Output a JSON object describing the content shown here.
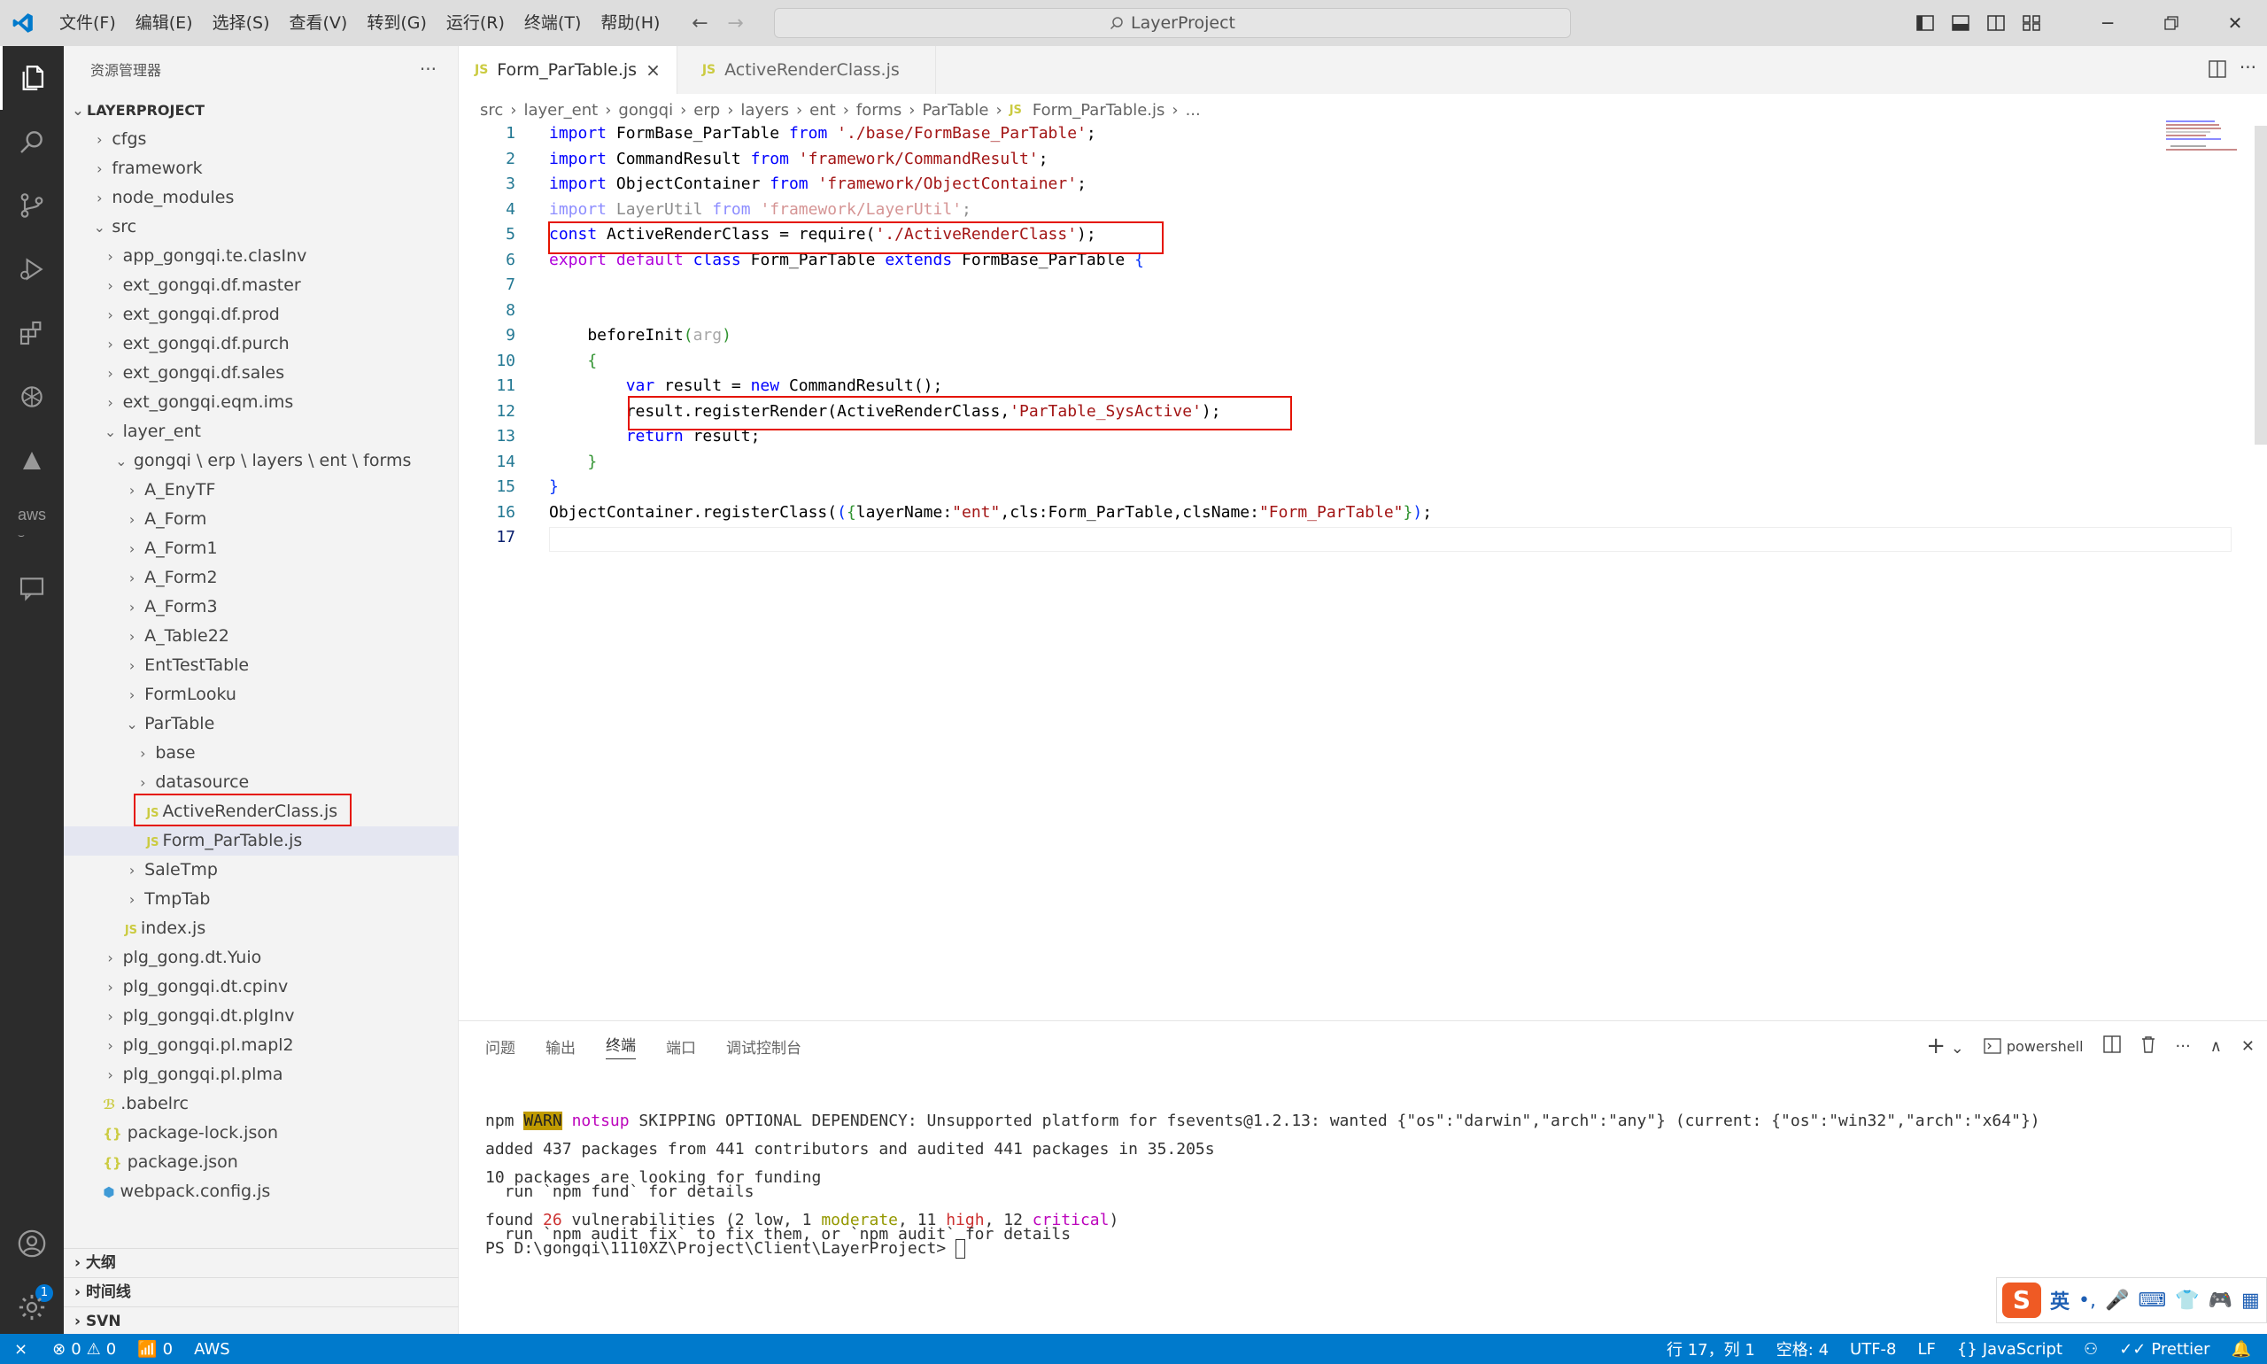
{
  "title_bar": {
    "menu": [
      "文件(F)",
      "编辑(E)",
      "选择(S)",
      "查看(V)",
      "转到(G)",
      "运行(R)",
      "终端(T)",
      "帮助(H)"
    ],
    "search": "LayerProject"
  },
  "sidebar": {
    "title": "资源管理器",
    "more": "···",
    "root": "LAYERPROJECT",
    "tree": [
      {
        "label": "cfgs",
        "indent": 0,
        "kind": "folder",
        "open": false
      },
      {
        "label": "framework",
        "indent": 0,
        "kind": "folder",
        "open": false
      },
      {
        "label": "node_modules",
        "indent": 0,
        "kind": "folder",
        "open": false
      },
      {
        "label": "src",
        "indent": 0,
        "kind": "folder",
        "open": true
      },
      {
        "label": "app_gongqi.te.clasInv",
        "indent": 1,
        "kind": "folder",
        "open": false
      },
      {
        "label": "ext_gongqi.df.master",
        "indent": 1,
        "kind": "folder",
        "open": false
      },
      {
        "label": "ext_gongqi.df.prod",
        "indent": 1,
        "kind": "folder",
        "open": false
      },
      {
        "label": "ext_gongqi.df.purch",
        "indent": 1,
        "kind": "folder",
        "open": false
      },
      {
        "label": "ext_gongqi.df.sales",
        "indent": 1,
        "kind": "folder",
        "open": false
      },
      {
        "label": "ext_gongqi.eqm.ims",
        "indent": 1,
        "kind": "folder",
        "open": false
      },
      {
        "label": "layer_ent",
        "indent": 1,
        "kind": "folder",
        "open": true
      },
      {
        "label": "gongqi \\ erp \\ layers \\ ent \\ forms",
        "indent": 2,
        "kind": "folder",
        "open": true
      },
      {
        "label": "A_EnyTF",
        "indent": 3,
        "kind": "folder",
        "open": false
      },
      {
        "label": "A_Form",
        "indent": 3,
        "kind": "folder",
        "open": false
      },
      {
        "label": "A_Form1",
        "indent": 3,
        "kind": "folder",
        "open": false
      },
      {
        "label": "A_Form2",
        "indent": 3,
        "kind": "folder",
        "open": false
      },
      {
        "label": "A_Form3",
        "indent": 3,
        "kind": "folder",
        "open": false
      },
      {
        "label": "A_Table22",
        "indent": 3,
        "kind": "folder",
        "open": false
      },
      {
        "label": "EntTestTable",
        "indent": 3,
        "kind": "folder",
        "open": false
      },
      {
        "label": "FormLooku",
        "indent": 3,
        "kind": "folder",
        "open": false
      },
      {
        "label": "ParTable",
        "indent": 3,
        "kind": "folder",
        "open": true
      },
      {
        "label": "base",
        "indent": 4,
        "kind": "folder",
        "open": false
      },
      {
        "label": "datasource",
        "indent": 4,
        "kind": "folder",
        "open": false
      },
      {
        "label": "ActiveRenderClass.js",
        "indent": 4,
        "kind": "js"
      },
      {
        "label": "Form_ParTable.js",
        "indent": 4,
        "kind": "js",
        "selected": true
      },
      {
        "label": "SaleTmp",
        "indent": 3,
        "kind": "folder",
        "open": false
      },
      {
        "label": "TmpTab",
        "indent": 3,
        "kind": "folder",
        "open": false
      },
      {
        "label": "index.js",
        "indent": 2,
        "kind": "js"
      },
      {
        "label": "plg_gong.dt.Yuio",
        "indent": 1,
        "kind": "folder",
        "open": false
      },
      {
        "label": "plg_gongqi.dt.cpinv",
        "indent": 1,
        "kind": "folder",
        "open": false
      },
      {
        "label": "plg_gongqi.dt.plgInv",
        "indent": 1,
        "kind": "folder",
        "open": false
      },
      {
        "label": "plg_gongqi.pl.mapl2",
        "indent": 1,
        "kind": "folder",
        "open": false
      },
      {
        "label": "plg_gongqi.pl.plma",
        "indent": 1,
        "kind": "folder",
        "open": false
      },
      {
        "label": ".babelrc",
        "indent": 0,
        "kind": "babel"
      },
      {
        "label": "package-lock.json",
        "indent": 0,
        "kind": "json"
      },
      {
        "label": "package.json",
        "indent": 0,
        "kind": "json"
      },
      {
        "label": "webpack.config.js",
        "indent": 0,
        "kind": "webpack"
      }
    ],
    "sections": [
      "大纲",
      "时间线",
      "SVN"
    ]
  },
  "tabs": [
    {
      "icon": "JS",
      "label": "Form_ParTable.js",
      "active": true,
      "close": "×"
    },
    {
      "icon": "JS",
      "label": "ActiveRenderClass.js",
      "active": false
    }
  ],
  "breadcrumb": [
    "src",
    "layer_ent",
    "gongqi",
    "erp",
    "layers",
    "ent",
    "forms",
    "ParTable",
    "Form_ParTable.js",
    "..."
  ],
  "breadcrumb_file_icon": "JS",
  "code": [
    {
      "n": "1",
      "parts": [
        [
          "kw",
          "import"
        ],
        [
          "pl",
          " FormBase_ParTable "
        ],
        [
          "kw",
          "from"
        ],
        [
          "pl",
          " "
        ],
        [
          "str",
          "'./base/FormBase_ParTable'"
        ],
        [
          "pl",
          ";"
        ]
      ]
    },
    {
      "n": "2",
      "parts": [
        [
          "kw",
          "import"
        ],
        [
          "pl",
          " CommandResult "
        ],
        [
          "kw",
          "from"
        ],
        [
          "pl",
          " "
        ],
        [
          "str",
          "'framework/CommandResult'"
        ],
        [
          "pl",
          ";"
        ]
      ]
    },
    {
      "n": "3",
      "parts": [
        [
          "kw",
          "import"
        ],
        [
          "pl",
          " ObjectContainer "
        ],
        [
          "kw",
          "from"
        ],
        [
          "pl",
          " "
        ],
        [
          "str",
          "'framework/ObjectContainer'"
        ],
        [
          "pl",
          ";"
        ]
      ]
    },
    {
      "n": "4",
      "dim": true,
      "parts": [
        [
          "kw",
          "import"
        ],
        [
          "pl",
          " LayerUtil "
        ],
        [
          "kw",
          "from"
        ],
        [
          "pl",
          " "
        ],
        [
          "str",
          "'framework/LayerUtil'"
        ],
        [
          "pl",
          ";"
        ]
      ]
    },
    {
      "n": "5",
      "parts": [
        [
          "kw",
          "const"
        ],
        [
          "pl",
          " ActiveRenderClass = require("
        ],
        [
          "str",
          "'./ActiveRenderClass'"
        ],
        [
          "pl",
          ");"
        ]
      ]
    },
    {
      "n": "6",
      "parts": [
        [
          "kw2",
          "export"
        ],
        [
          "pl",
          " "
        ],
        [
          "kw2",
          "default"
        ],
        [
          "pl",
          " "
        ],
        [
          "kw",
          "class"
        ],
        [
          "pl",
          " Form_ParTable "
        ],
        [
          "kw",
          "extends"
        ],
        [
          "pl",
          " FormBase_ParTable "
        ],
        [
          "br1",
          "{"
        ]
      ]
    },
    {
      "n": "7",
      "parts": []
    },
    {
      "n": "8",
      "parts": []
    },
    {
      "n": "9",
      "parts": [
        [
          "pl",
          "    beforeInit"
        ],
        [
          "br2",
          "("
        ],
        [
          "dim",
          "arg"
        ],
        [
          "br2",
          ")"
        ]
      ]
    },
    {
      "n": "10",
      "parts": [
        [
          "br2",
          "    {"
        ]
      ]
    },
    {
      "n": "11",
      "parts": [
        [
          "kw",
          "        var"
        ],
        [
          "pl",
          " result = "
        ],
        [
          "kw",
          "new"
        ],
        [
          "pl",
          " CommandResult();"
        ]
      ]
    },
    {
      "n": "12",
      "parts": [
        [
          "pl",
          "        result.registerRender(ActiveRenderClass,"
        ],
        [
          "str",
          "'ParTable_SysActive'"
        ],
        [
          "pl",
          ");"
        ]
      ]
    },
    {
      "n": "13",
      "parts": [
        [
          "kw",
          "        return"
        ],
        [
          "pl",
          " result;"
        ]
      ]
    },
    {
      "n": "14",
      "parts": [
        [
          "br2",
          "    }"
        ]
      ]
    },
    {
      "n": "15",
      "parts": [
        [
          "br1",
          "}"
        ]
      ]
    },
    {
      "n": "16",
      "parts": [
        [
          "pl",
          "ObjectContainer.registerClass("
        ],
        [
          "br1",
          "("
        ],
        [
          "br2",
          "{"
        ],
        [
          "pl",
          "layerName:"
        ],
        [
          "str",
          "\"ent\""
        ],
        [
          "pl",
          ",cls:Form_ParTable,clsName:"
        ],
        [
          "str",
          "\"Form_ParTable\""
        ],
        [
          "br2",
          "}"
        ],
        [
          "br1",
          ")"
        ],
        [
          "pl",
          ";"
        ]
      ]
    },
    {
      "n": "17",
      "parts": [],
      "current": true
    }
  ],
  "panel": {
    "tabs": [
      "问题",
      "输出",
      "终端",
      "端口",
      "调试控制台"
    ],
    "active_tab": "终端",
    "shell": "powershell",
    "add": "+",
    "terminal": [
      [
        [
          "pl",
          "npm "
        ],
        [
          "warn",
          "WARN"
        ],
        [
          "pl",
          " "
        ],
        [
          "mag",
          "notsup"
        ],
        [
          "pl",
          " SKIPPING OPTIONAL DEPENDENCY: Unsupported platform for fsevents@1.2.13: wanted {\"os\":\"darwin\",\"arch\":\"any\"} (current: {\"os\":\"win32\",\"arch\":\"x64\"})"
        ]
      ],
      [],
      [
        [
          "pl",
          "added 437 packages from 441 contributors and audited 441 packages in 35.205s"
        ]
      ],
      [],
      [
        [
          "pl",
          "10 packages are looking for funding"
        ]
      ],
      [
        [
          "pl",
          "  run `npm fund` for details"
        ]
      ],
      [],
      [
        [
          "pl",
          "found "
        ],
        [
          "red",
          "26"
        ],
        [
          "pl",
          " vulnerabilities (2 low, 1 "
        ],
        [
          "yel",
          "moderate"
        ],
        [
          "pl",
          ", 11 "
        ],
        [
          "red",
          "high"
        ],
        [
          "pl",
          ", 12 "
        ],
        [
          "mag",
          "critical"
        ],
        [
          "pl",
          ")"
        ]
      ],
      [
        [
          "pl",
          "  run `npm audit fix` to fix them, or `npm audit` for details"
        ]
      ],
      [
        [
          "pl",
          "PS D:\\gongqi\\1110XZ\\Project\\Client\\LayerProject> "
        ]
      ]
    ]
  },
  "statusbar": {
    "remote": "⨯",
    "errors": "0",
    "warnings": "0",
    "ports": "0",
    "aws": "AWS",
    "position": "行 17，列 1",
    "spaces": "空格: 4",
    "encoding": "UTF-8",
    "eol": "LF",
    "language": "JavaScript",
    "prettier": "Prettier",
    "bell": "🔔",
    "badge": "1"
  },
  "ime": {
    "lang": "英",
    "punct": "•,"
  },
  "colors": {
    "accent": "#007acc",
    "highlight_box": "#e51400"
  }
}
